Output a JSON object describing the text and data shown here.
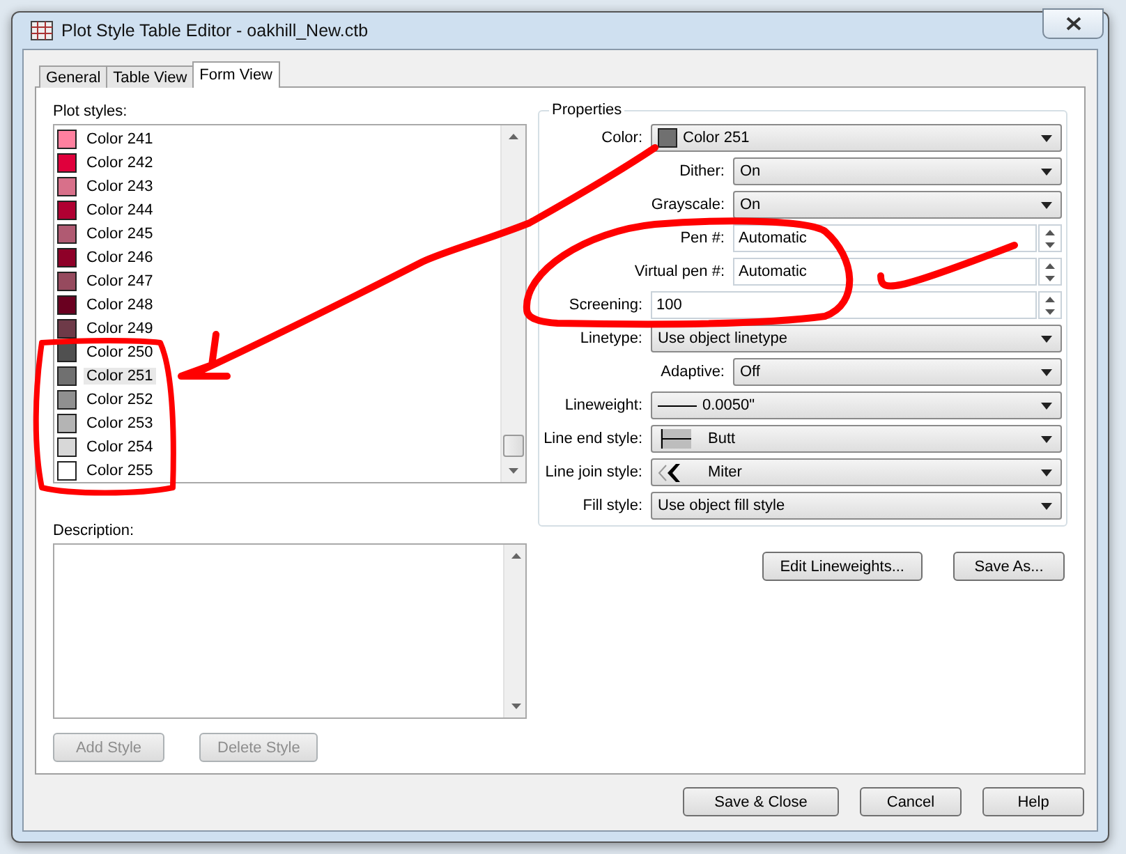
{
  "window": {
    "title": "Plot Style Table Editor - oakhill_New.ctb"
  },
  "tabs": [
    {
      "label": "General",
      "selected": false
    },
    {
      "label": "Table View",
      "selected": false
    },
    {
      "label": "Form View",
      "selected": true
    }
  ],
  "plot_styles": {
    "label": "Plot styles:",
    "items": [
      {
        "label": "Color 241",
        "color": "#ff809f",
        "selected": false
      },
      {
        "label": "Color 242",
        "color": "#e0003c",
        "selected": false
      },
      {
        "label": "Color 243",
        "color": "#d8708a",
        "selected": false
      },
      {
        "label": "Color 244",
        "color": "#b00032",
        "selected": false
      },
      {
        "label": "Color 245",
        "color": "#b05a72",
        "selected": false
      },
      {
        "label": "Color 246",
        "color": "#8e0028",
        "selected": false
      },
      {
        "label": "Color 247",
        "color": "#964a5e",
        "selected": false
      },
      {
        "label": "Color 248",
        "color": "#6a0020",
        "selected": false
      },
      {
        "label": "Color 249",
        "color": "#6e3a48",
        "selected": false
      },
      {
        "label": "Color 250",
        "color": "#505050",
        "selected": false
      },
      {
        "label": "Color 251",
        "color": "#707070",
        "selected": true
      },
      {
        "label": "Color 252",
        "color": "#909090",
        "selected": false
      },
      {
        "label": "Color 253",
        "color": "#b4b4b4",
        "selected": false
      },
      {
        "label": "Color 254",
        "color": "#d8d8d8",
        "selected": false
      },
      {
        "label": "Color 255",
        "color": "#ffffff",
        "selected": false
      }
    ]
  },
  "description": {
    "label": "Description:"
  },
  "style_buttons": [
    {
      "label": "Add Style",
      "disabled": true
    },
    {
      "label": "Delete Style",
      "disabled": true
    }
  ],
  "properties": {
    "title": "Properties",
    "rows": [
      {
        "label": "Color:",
        "kind": "color",
        "value": "Color 251",
        "color": "#707070",
        "indented": false
      },
      {
        "label": "Dither:",
        "kind": "dropdown",
        "value": "On",
        "indented": true
      },
      {
        "label": "Grayscale:",
        "kind": "dropdown",
        "value": "On",
        "indented": true
      },
      {
        "label": "Pen #:",
        "kind": "spinner",
        "value": "Automatic",
        "indented": true
      },
      {
        "label": "Virtual pen #:",
        "kind": "spinner",
        "value": "Automatic",
        "indented": true
      },
      {
        "label": "Screening:",
        "kind": "spinner",
        "value": "100",
        "indented": false
      },
      {
        "label": "Linetype:",
        "kind": "dropdown",
        "value": "Use object linetype",
        "indented": false
      },
      {
        "label": "Adaptive:",
        "kind": "dropdown",
        "value": "Off",
        "indented": true
      },
      {
        "label": "Lineweight:",
        "kind": "lineweight",
        "value": "0.0050\"",
        "indented": false
      },
      {
        "label": "Line end style:",
        "kind": "endstyle",
        "value": "Butt",
        "indented": false
      },
      {
        "label": "Line join style:",
        "kind": "joinstyle",
        "value": "Miter",
        "indented": false
      },
      {
        "label": "Fill style:",
        "kind": "dropdown",
        "value": "Use object fill style",
        "indented": false
      }
    ]
  },
  "property_buttons": [
    {
      "label": "Edit Lineweights..."
    },
    {
      "label": "Save As..."
    }
  ],
  "dialog_buttons": [
    {
      "label": "Save & Close"
    },
    {
      "label": "Cancel"
    },
    {
      "label": "Help"
    }
  ]
}
